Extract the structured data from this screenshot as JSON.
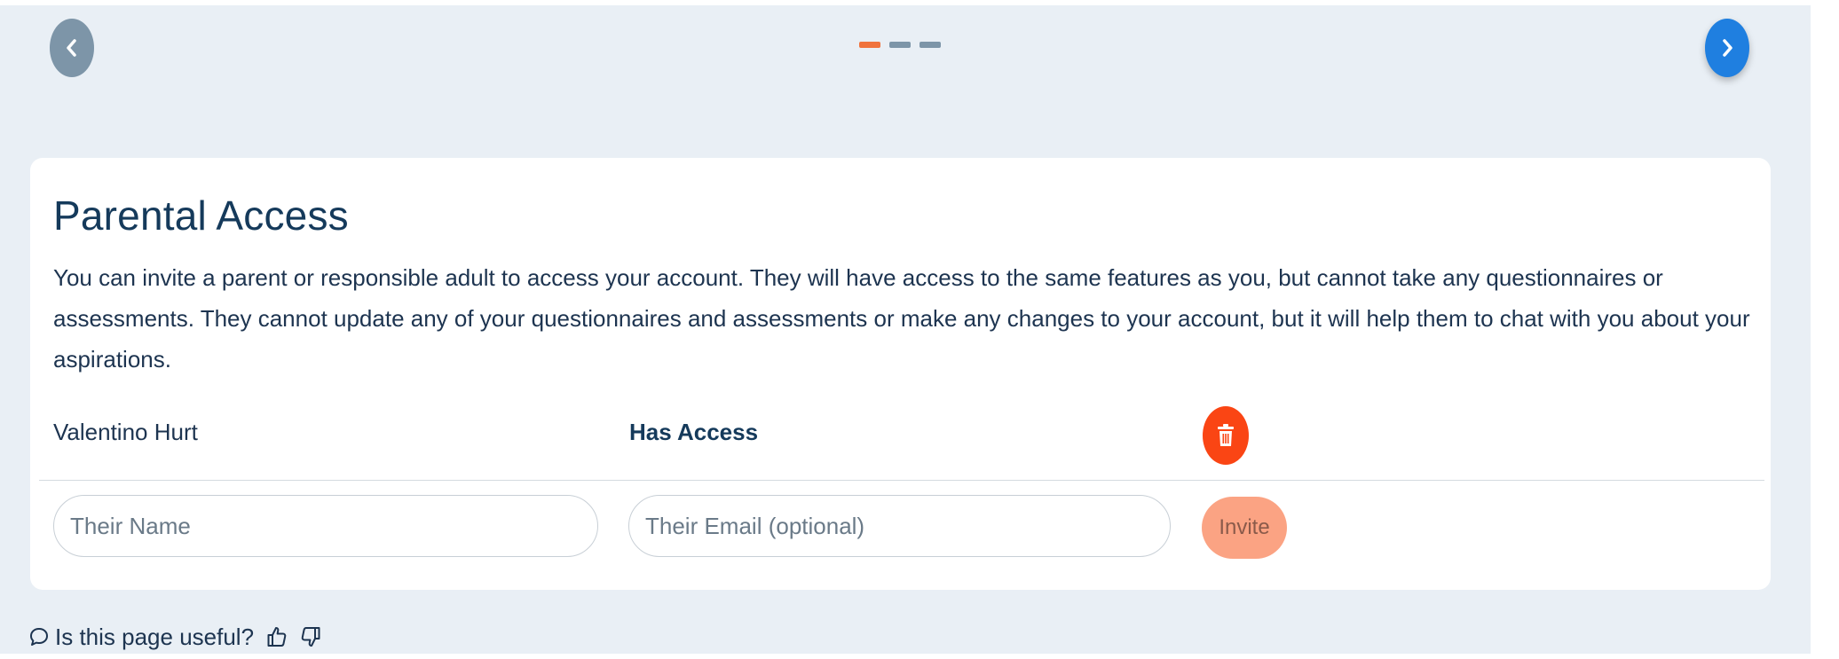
{
  "carousel": {
    "prev_icon": "chevron-left-icon",
    "next_icon": "chevron-right-icon",
    "pages": [
      {
        "active": true
      },
      {
        "active": false
      },
      {
        "active": false
      }
    ],
    "colors": {
      "prev_bg": "#7d95a8",
      "next_bg": "#1f7fe0",
      "dot_active": "#f0733d",
      "dot_inactive": "#7d95a8"
    }
  },
  "parental_access": {
    "title": "Parental Access",
    "description": "You can invite a parent or responsible adult to access your account. They will have access to the same features as you, but cannot take any questionnaires or assessments. They cannot update any of your questionnaires and assessments or make any changes to your account, but it will help them to chat with you about your aspirations.",
    "members": [
      {
        "name": "Valentino Hurt",
        "status": "Has Access",
        "delete_icon": "trash-icon"
      }
    ],
    "invite_form": {
      "name_placeholder": "Their Name",
      "name_value": "",
      "email_placeholder": "Their Email (optional)",
      "email_value": "",
      "invite_label": "Invite"
    },
    "colors": {
      "title": "#153a5b",
      "delete_bg": "#fa4514",
      "invite_bg": "#fba383"
    }
  },
  "feedback": {
    "question": "Is this page useful?",
    "comment_icon": "comment-icon",
    "like_icon": "thumbs-up-icon",
    "dislike_icon": "thumbs-down-icon"
  }
}
